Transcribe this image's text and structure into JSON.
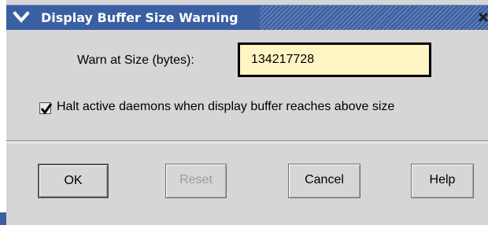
{
  "window": {
    "title": "Display Buffer Size Warning",
    "menu_icon": "chevron-down-icon",
    "close_icon": "close-icon"
  },
  "form": {
    "warn_label": "Warn at Size (bytes):",
    "warn_value": "134217728",
    "halt_checked": true,
    "halt_label": "Halt active daemons when display buffer reaches above size"
  },
  "buttons": {
    "ok": "OK",
    "reset": "Reset",
    "cancel": "Cancel",
    "help": "Help"
  },
  "colors": {
    "titlebar": "#3a5fa3",
    "input_bg": "#fff4c3",
    "dialog_bg": "#d6d6d6"
  }
}
